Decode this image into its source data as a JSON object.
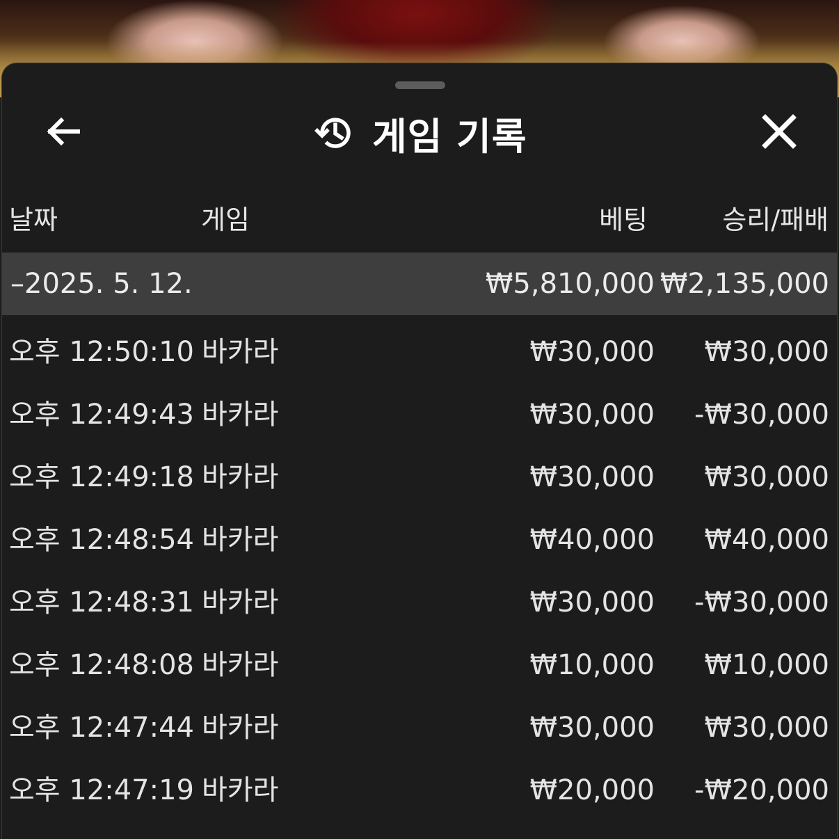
{
  "header": {
    "title": "게임 기록",
    "back_icon": "arrow-left-icon",
    "history_icon": "history-icon",
    "close_icon": "close-icon"
  },
  "columns": {
    "date": "날짜",
    "game": "게임",
    "bet": "베팅",
    "win_loss": "승리/패배"
  },
  "summary": {
    "date": "–2025. 5. 12.",
    "bet": "₩5,810,000",
    "win_loss": "₩2,135,000"
  },
  "rows": [
    {
      "time": "오후 12:50:10",
      "game": "바카라",
      "bet": "₩30,000",
      "win_loss": "₩30,000"
    },
    {
      "time": "오후 12:49:43",
      "game": "바카라",
      "bet": "₩30,000",
      "win_loss": "-₩30,000"
    },
    {
      "time": "오후 12:49:18",
      "game": "바카라",
      "bet": "₩30,000",
      "win_loss": "₩30,000"
    },
    {
      "time": "오후 12:48:54",
      "game": "바카라",
      "bet": "₩40,000",
      "win_loss": "₩40,000"
    },
    {
      "time": "오후 12:48:31",
      "game": "바카라",
      "bet": "₩30,000",
      "win_loss": "-₩30,000"
    },
    {
      "time": "오후 12:48:08",
      "game": "바카라",
      "bet": "₩10,000",
      "win_loss": "₩10,000"
    },
    {
      "time": "오후 12:47:44",
      "game": "바카라",
      "bet": "₩30,000",
      "win_loss": "₩30,000"
    },
    {
      "time": "오후 12:47:19",
      "game": "바카라",
      "bet": "₩20,000",
      "win_loss": "-₩20,000"
    }
  ],
  "colors": {
    "sheet_bg": "#1c1c1c",
    "summary_bg": "#3e3e3e",
    "text": "#e4e4e4",
    "title": "#ffffff"
  }
}
